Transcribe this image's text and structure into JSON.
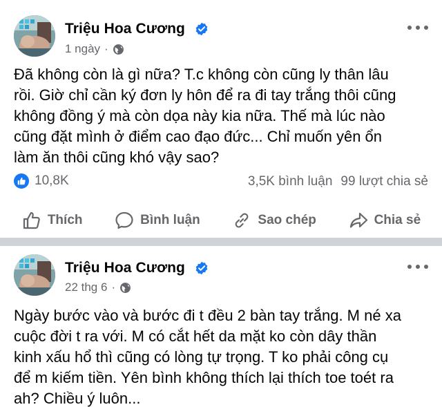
{
  "posts": [
    {
      "author": "Triệu Hoa Cương",
      "time": "1 ngày",
      "dot": "·",
      "text": "Đã không còn là gì nữa? T.c không còn cũng ly thân lâu\nrồi. Giờ chỉ cần ký đơn ly hôn để ra đi tay trắng thôi cũng\nkhông đồng ý mà còn dọa này kia nữa. Thế mà lúc nào\ncũng đặt mình ở điểm cao đạo đức... Chỉ muốn yên ổn\nlàm ăn thôi cũng khó vậy sao?",
      "reactions_count": "10,8K",
      "comments": "3,5K bình luận",
      "shares": "99 lượt chia sẻ",
      "actions": {
        "like": "Thích",
        "comment": "Bình luận",
        "copy": "Sao chép",
        "share": "Chia sẻ"
      }
    },
    {
      "author": "Triệu Hoa Cương",
      "time": "22 thg 6",
      "dot": "·",
      "text": "Ngày bước vào và bước đi t đều 2 bàn tay trắng. M né xa\ncuộc đời t ra với. M có cắt hết da mặt ko còn dây thần\nkinh xấu hổ thì cũng có lòng tự trọng. T ko phải công cụ\nđể m kiếm tiền. Yên bình không thích lại thích toe toét ra\nah? Chiều ý luôn..."
    }
  ],
  "colors": {
    "primary_text": "#050505",
    "secondary_text": "#65676b",
    "verified_blue": "#1877f2",
    "separator": "#cfd2d6"
  },
  "icons": {
    "verified": "verified-badge-icon",
    "privacy": "globe-icon",
    "more": "more-horizontal-icon",
    "like_reaction": "like-reaction-icon",
    "like": "thumbs-up-icon",
    "comment": "speech-bubble-icon",
    "copy": "link-icon",
    "share": "share-arrow-icon"
  }
}
